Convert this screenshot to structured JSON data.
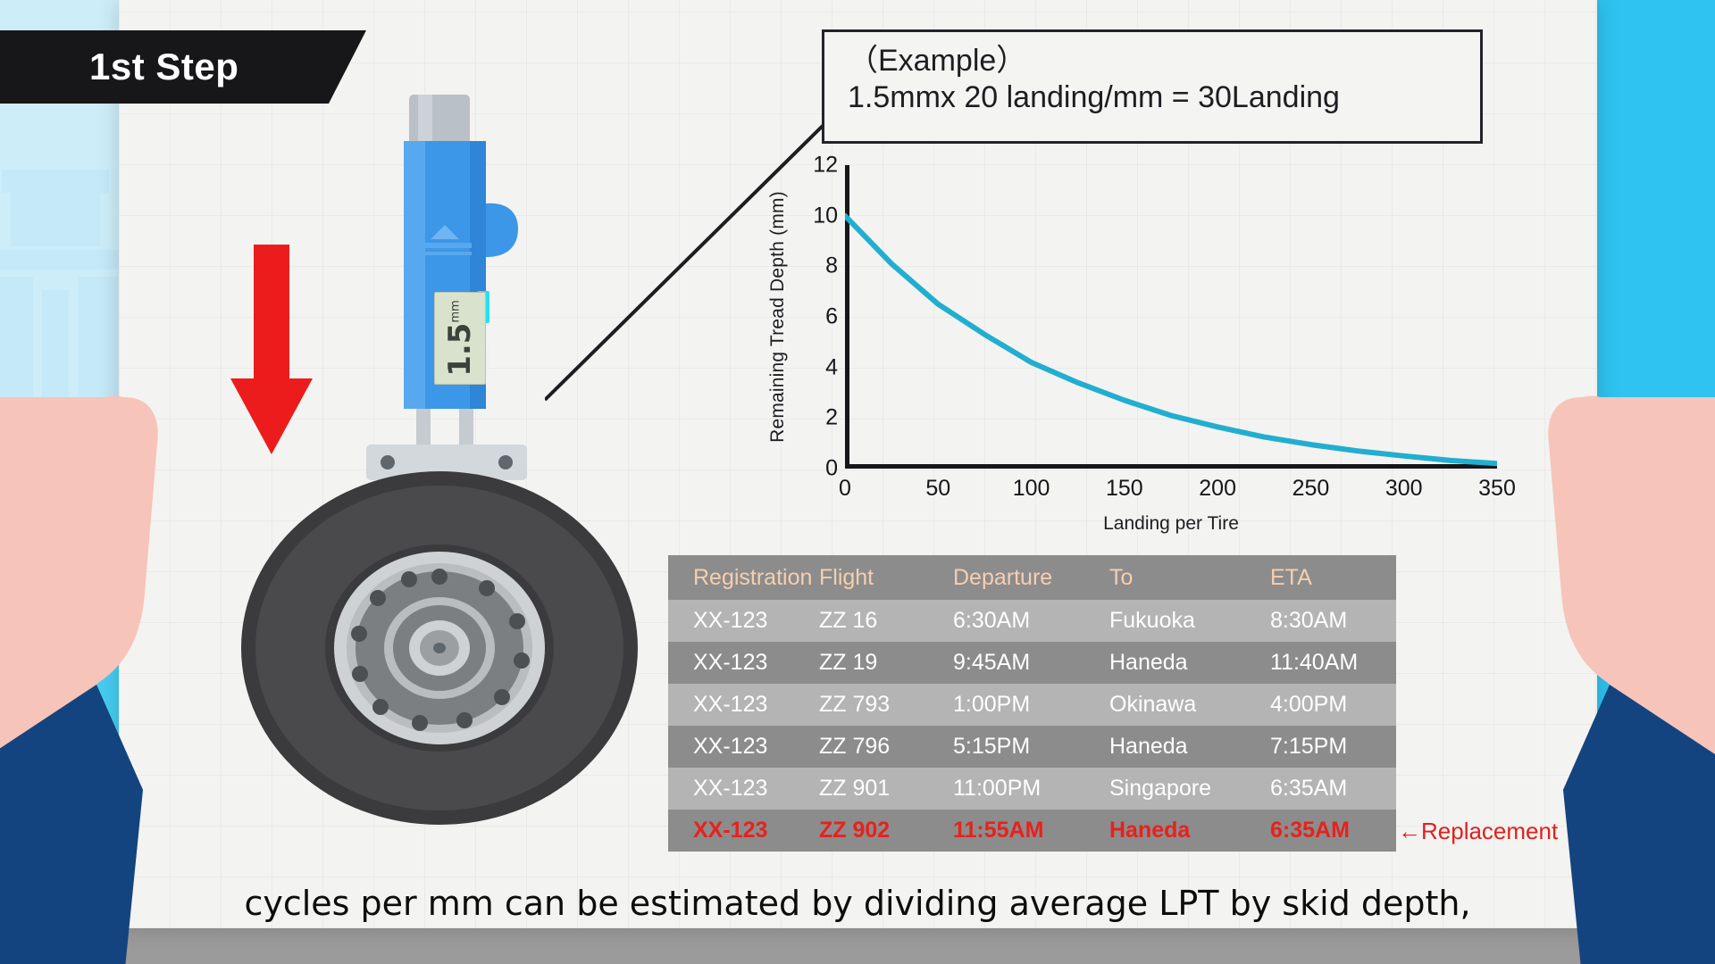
{
  "banner": {
    "step_label": "1st Step"
  },
  "gauge": {
    "value": "1.5",
    "unit": "mm",
    "name": "tread-depth-gauge"
  },
  "callout": {
    "line1": "（Example）",
    "line2": "1.5mmx 20 landing/mm = 30Landing"
  },
  "chart_data": {
    "type": "line",
    "title": "",
    "xlabel": "Landing per Tire",
    "ylabel": "Remaining Tread Depth (mm)",
    "xlim": [
      0,
      350
    ],
    "ylim": [
      0,
      12
    ],
    "xticks": [
      0,
      50,
      100,
      150,
      200,
      250,
      300,
      350
    ],
    "yticks": [
      0,
      2,
      4,
      6,
      8,
      10,
      12
    ],
    "grid": false,
    "legend": "none",
    "line_color": "#21AED0",
    "series": [
      {
        "name": "Remaining Tread Depth",
        "x": [
          0,
          25,
          50,
          75,
          100,
          125,
          150,
          175,
          200,
          225,
          250,
          275,
          300,
          325,
          350
        ],
        "y": [
          10.0,
          8.1,
          6.5,
          5.3,
          4.2,
          3.4,
          2.7,
          2.1,
          1.65,
          1.25,
          0.95,
          0.7,
          0.5,
          0.32,
          0.2
        ]
      }
    ]
  },
  "flight_table": {
    "columns": [
      "Registration",
      "Flight",
      "Departure",
      "To",
      "ETA"
    ],
    "rows": [
      {
        "registration": "XX-123",
        "flight": "ZZ 16",
        "departure": "6:30AM",
        "to": "Fukuoka",
        "eta": "8:30AM",
        "alert": false
      },
      {
        "registration": "XX-123",
        "flight": "ZZ 19",
        "departure": "9:45AM",
        "to": "Haneda",
        "eta": "11:40AM",
        "alert": false
      },
      {
        "registration": "XX-123",
        "flight": "ZZ 793",
        "departure": "1:00PM",
        "to": "Okinawa",
        "eta": "4:00PM",
        "alert": false
      },
      {
        "registration": "XX-123",
        "flight": "ZZ 796",
        "departure": "5:15PM",
        "to": "Haneda",
        "eta": "7:15PM",
        "alert": false
      },
      {
        "registration": "XX-123",
        "flight": "ZZ 901",
        "departure": "11:00PM",
        "to": "Singapore",
        "eta": "6:35AM",
        "alert": false
      },
      {
        "registration": "XX-123",
        "flight": "ZZ 902",
        "departure": "11:55AM",
        "to": "Haneda",
        "eta": "6:35AM",
        "alert": true
      }
    ],
    "annotation": "←Replacement"
  },
  "caption": {
    "text": "cycles per mm can be estimated by dividing average LPT by skid depth,"
  },
  "colors": {
    "banner_bg": "#17171a",
    "arrow_red": "#ed1c1c",
    "curve": "#21AED0",
    "alert_red": "#e8211c",
    "header_text": "#f6cfae",
    "sky": "#2ec3f0",
    "grass": "#63cb48",
    "skin": "#f7c4b9",
    "sleeve": "#14447f",
    "gauge_blue": "#3d97e8"
  }
}
